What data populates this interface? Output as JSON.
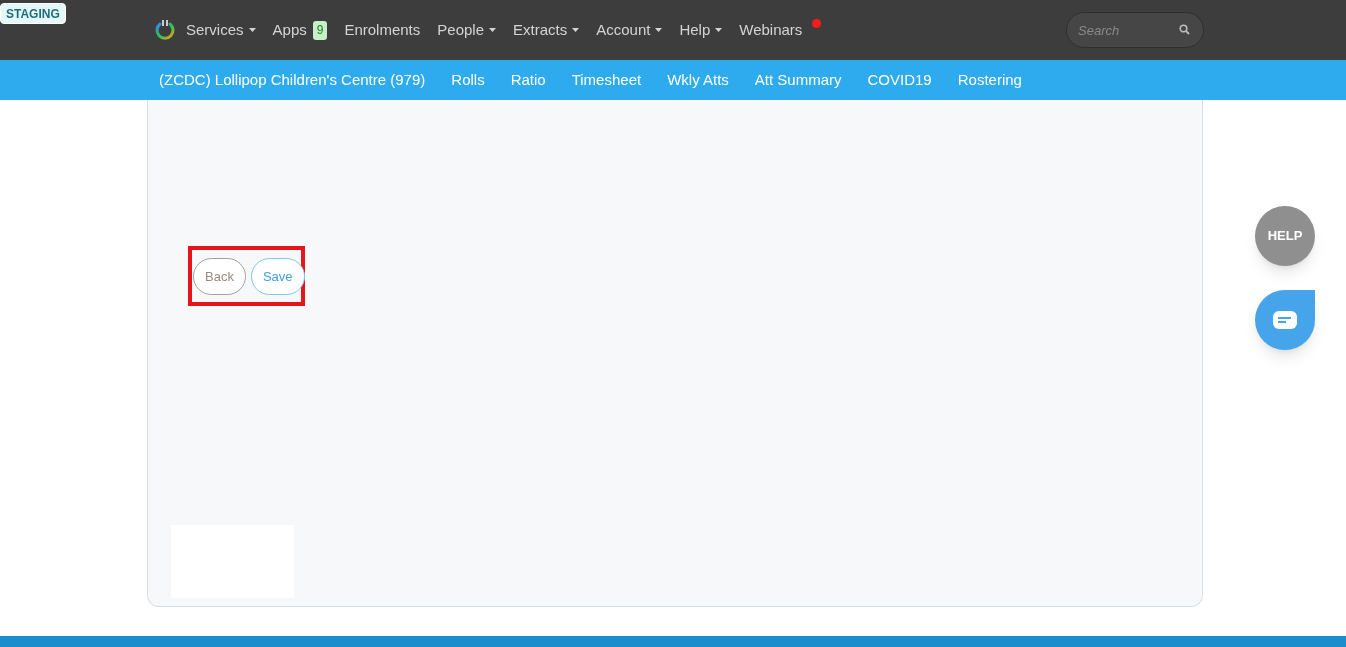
{
  "badge": "STAGING",
  "nav": [
    {
      "label": "Services",
      "dropdown": true
    },
    {
      "label": "Apps",
      "dropdown": false,
      "count": "9"
    },
    {
      "label": "Enrolments",
      "dropdown": false
    },
    {
      "label": "People",
      "dropdown": true
    },
    {
      "label": "Extracts",
      "dropdown": true
    },
    {
      "label": "Account",
      "dropdown": true
    },
    {
      "label": "Help",
      "dropdown": true
    },
    {
      "label": "Webinars",
      "dropdown": false,
      "notification": true
    }
  ],
  "search": {
    "placeholder": "Search"
  },
  "subnav": [
    "(ZCDC) Lollipop Children's Centre (979)",
    "Rolls",
    "Ratio",
    "Timesheet",
    "Wkly Atts",
    "Att Summary",
    "COVID19",
    "Rostering"
  ],
  "buttons": [
    {
      "label": "Back",
      "kind": "back"
    },
    {
      "label": "Save",
      "kind": "save"
    }
  ],
  "help_button": "HELP"
}
